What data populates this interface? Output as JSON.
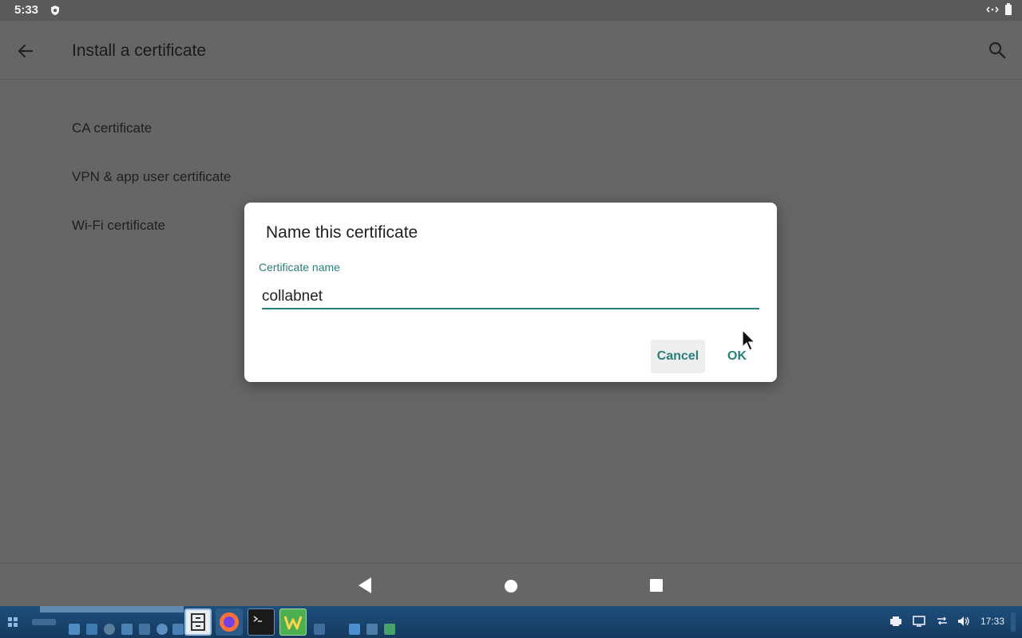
{
  "status_bar": {
    "time": "5:33",
    "shield_icon": "shield-icon",
    "network_icon": "network-icon",
    "battery_icon": "battery-icon"
  },
  "app_bar": {
    "title": "Install a certificate",
    "back_icon": "arrow-back-icon",
    "search_icon": "search-icon"
  },
  "list": {
    "items": [
      {
        "label": "CA certificate"
      },
      {
        "label": "VPN & app user certificate"
      },
      {
        "label": "Wi-Fi certificate"
      }
    ]
  },
  "dialog": {
    "title": "Name this certificate",
    "field_label": "Certificate name",
    "field_value": "collabnet",
    "cancel_label": "Cancel",
    "ok_label": "OK"
  },
  "nav_bar": {
    "back_icon": "triangle-back-icon",
    "home_icon": "circle-home-icon",
    "recents_icon": "square-recents-icon"
  },
  "taskbar": {
    "clock": "17:33"
  },
  "colors": {
    "accent": "#2a7f7a",
    "scrim": "#666666",
    "dialog_bg": "#ffffff"
  }
}
